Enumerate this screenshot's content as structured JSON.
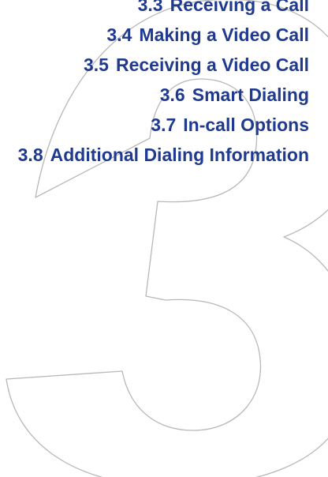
{
  "colors": {
    "heading": "#1f3a8f",
    "numeral_outline": "#b8b8b8"
  },
  "chapter_numeral": {
    "icon": "chapter-3-outline-numeral"
  },
  "toc": {
    "items": [
      {
        "number": "3.3",
        "title": "Receiving a Call"
      },
      {
        "number": "3.4",
        "title": "Making a Video Call"
      },
      {
        "number": "3.5",
        "title": "Receiving a Video Call"
      },
      {
        "number": "3.6",
        "title": "Smart Dialing"
      },
      {
        "number": "3.7",
        "title": "In-call Options"
      },
      {
        "number": "3.8",
        "title": "Additional Dialing Information"
      }
    ]
  }
}
